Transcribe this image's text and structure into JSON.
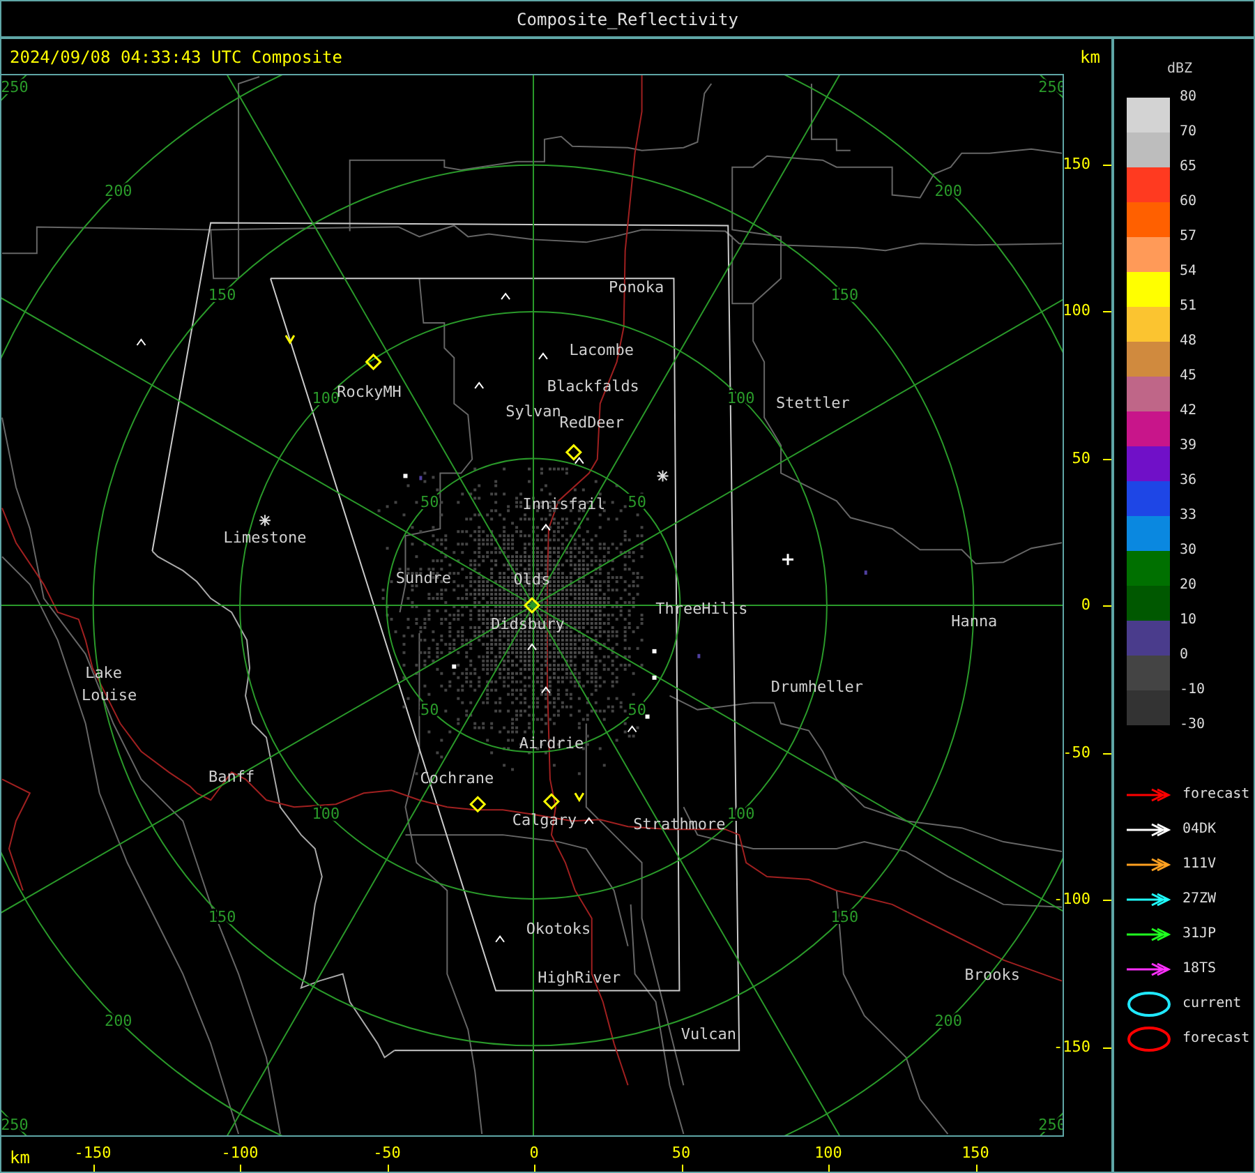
{
  "window": {
    "title": "Composite_Reflectivity"
  },
  "header": {
    "timestamp": "2024/09/08 04:33:43 UTC Composite",
    "unit": "km"
  },
  "map": {
    "range_rings": [
      {
        "labels": [
          "50",
          "50",
          "50",
          "50"
        ]
      },
      {
        "labels": [
          "100",
          "100",
          "100",
          "100"
        ]
      },
      {
        "labels": [
          "150",
          "150",
          "150",
          "150"
        ]
      },
      {
        "labels": [
          "200",
          "200",
          "200",
          "200"
        ]
      },
      {
        "labels": [
          "250",
          "250",
          "250",
          "250"
        ]
      }
    ],
    "places": [
      {
        "name": "Ponoka"
      },
      {
        "name": "Lacombe"
      },
      {
        "name": "Blackfalds"
      },
      {
        "name": "Stettler"
      },
      {
        "name": "RockyMH"
      },
      {
        "name": "Sylvan"
      },
      {
        "name": "RedDeer"
      },
      {
        "name": "Innisfail"
      },
      {
        "name": "Limestone"
      },
      {
        "name": "Sundre"
      },
      {
        "name": "Olds"
      },
      {
        "name": "ThreeHills"
      },
      {
        "name": "Hanna"
      },
      {
        "name": "Didsbury"
      },
      {
        "name": "Lake"
      },
      {
        "name": "Louise"
      },
      {
        "name": "Drumheller"
      },
      {
        "name": "Airdrie"
      },
      {
        "name": "Banff"
      },
      {
        "name": "Cochrane"
      },
      {
        "name": "Calgary"
      },
      {
        "name": "Strathmore"
      },
      {
        "name": "Okotoks"
      },
      {
        "name": "HighRiver"
      },
      {
        "name": "Brooks"
      },
      {
        "name": "Vulcan"
      }
    ]
  },
  "y_axis": {
    "ticks": [
      "150",
      "100",
      "50",
      "0",
      "-50",
      "-100",
      "-150"
    ]
  },
  "x_axis": {
    "unit": "km",
    "ticks": [
      "-150",
      "-100",
      "-50",
      "0",
      "50",
      "100",
      "150"
    ]
  },
  "legend": {
    "title": "dBZ",
    "labels": [
      "80",
      "70",
      "65",
      "60",
      "57",
      "54",
      "51",
      "48",
      "45",
      "42",
      "39",
      "36",
      "33",
      "30",
      "20",
      "10",
      "0",
      "-10",
      "-30"
    ],
    "bands": [
      {
        "color": "#d3d3d3"
      },
      {
        "color": "#bdbdbd"
      },
      {
        "color": "#ff3a20"
      },
      {
        "color": "#ff6000"
      },
      {
        "color": "#ff9a58"
      },
      {
        "color": "#ffff00"
      },
      {
        "color": "#fbc430"
      },
      {
        "color": "#d08a3e"
      },
      {
        "color": "#bf6688"
      },
      {
        "color": "#c8158a"
      },
      {
        "color": "#7010c8"
      },
      {
        "color": "#1e46e6"
      },
      {
        "color": "#0a88e0"
      },
      {
        "color": "#007000"
      },
      {
        "color": "#005800"
      },
      {
        "color": "#4a3c8c"
      },
      {
        "color": "#444444"
      },
      {
        "color": "#333333"
      }
    ]
  },
  "tracks": [
    {
      "kind": "arrow",
      "label": "forecast",
      "color": "#ff0000"
    },
    {
      "kind": "arrow",
      "label": "04DK",
      "color": "#ffffff"
    },
    {
      "kind": "arrow",
      "label": "111V",
      "color": "#ffa020"
    },
    {
      "kind": "arrow",
      "label": "27ZW",
      "color": "#20ffff"
    },
    {
      "kind": "arrow",
      "label": "31JP",
      "color": "#20ff20"
    },
    {
      "kind": "arrow",
      "label": "18TS",
      "color": "#ff30ff"
    },
    {
      "kind": "ellipse",
      "label": "current",
      "color": "#20e8ff"
    },
    {
      "kind": "ellipse",
      "label": "forecast",
      "color": "#ff0000"
    }
  ]
}
